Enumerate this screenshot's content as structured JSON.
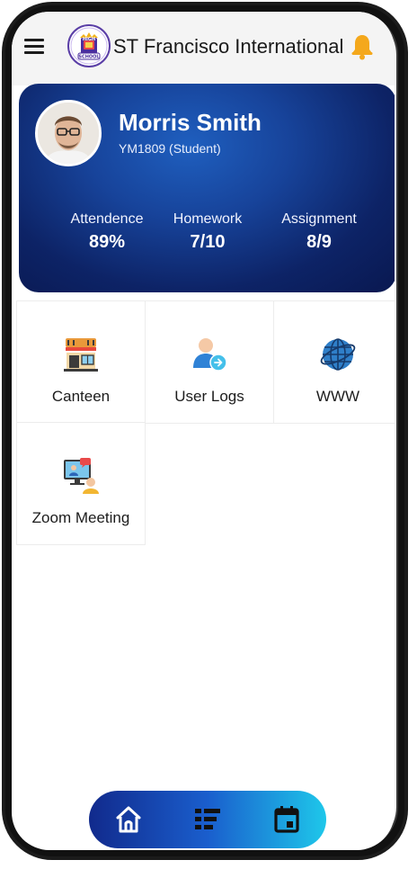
{
  "app": {
    "title": "ST Francisco International",
    "logo_text_top": "HIGH",
    "logo_text_bottom": "SCHOOL"
  },
  "profile": {
    "name": "Morris Smith",
    "id_line": "YM1809 (Student)",
    "stats": [
      {
        "label": "Attendence",
        "value": "89%"
      },
      {
        "label": "Homework",
        "value": "7/10"
      },
      {
        "label": "Assignment",
        "value": "8/9"
      }
    ]
  },
  "tiles": [
    {
      "label": "Canteen",
      "icon": "canteen-icon"
    },
    {
      "label": "User Logs",
      "icon": "user-logs-icon"
    },
    {
      "label": "WWW",
      "icon": "globe-icon"
    },
    {
      "label": "Zoom Meeting",
      "icon": "zoom-meeting-icon"
    }
  ],
  "bottom_nav": {
    "items": [
      "home-icon",
      "list-icon",
      "calendar-icon"
    ]
  },
  "colors": {
    "card_gradient_start": "#1f5fbf",
    "card_gradient_end": "#091850",
    "nav_gradient_start": "#112a8c",
    "nav_gradient_end": "#1ec7ea",
    "bell": "#f4a81c"
  }
}
